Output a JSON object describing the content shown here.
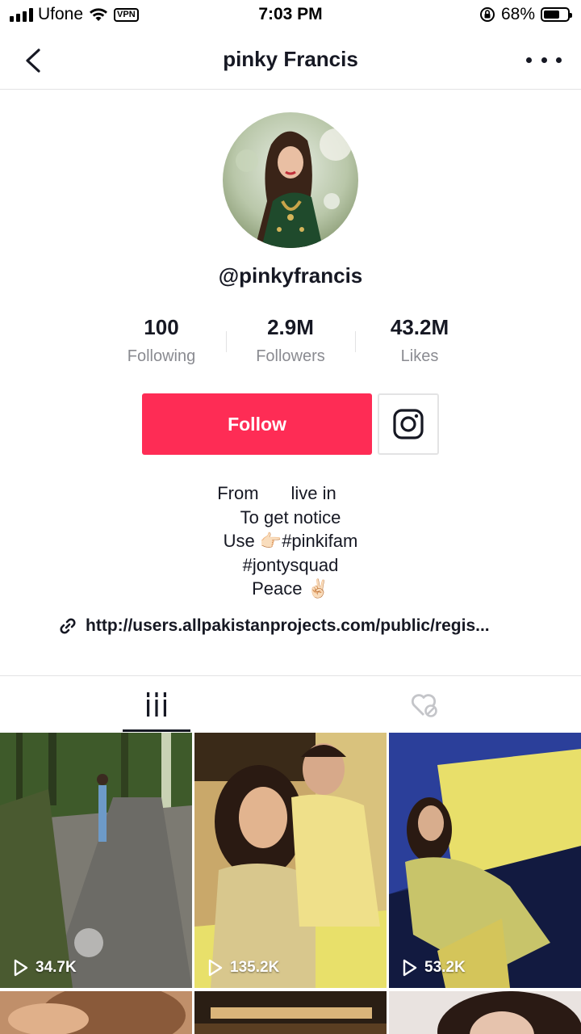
{
  "status_bar": {
    "carrier": "Ufone",
    "vpn_label": "VPN",
    "time": "7:03 PM",
    "battery_percent": "68%",
    "battery_level": 0.68
  },
  "header": {
    "title": "pinky Francis"
  },
  "profile": {
    "username": "@pinkyfrancis",
    "stats": [
      {
        "value": "100",
        "label": "Following"
      },
      {
        "value": "2.9M",
        "label": "Followers"
      },
      {
        "value": "43.2M",
        "label": "Likes"
      }
    ],
    "follow_label": "Follow",
    "bio": {
      "line1_a": "From",
      "line1_b": "live in",
      "line2": "To get notice",
      "line3_a": "Use",
      "line3_b": "#pinkifam",
      "line4": "#jontysquad",
      "line5": "Peace",
      "pointing_emoji": "👉🏻",
      "peace_emoji": "✌🏻"
    },
    "link": "http://users.allpakistanprojects.com/public/regis..."
  },
  "tabs": [
    {
      "name": "videos",
      "icon": "videos-grid-icon",
      "active": true
    },
    {
      "name": "liked",
      "icon": "liked-hidden-heart-icon",
      "active": false
    }
  ],
  "videos": [
    {
      "views": "34.7K"
    },
    {
      "views": "135.2K"
    },
    {
      "views": "53.2K"
    }
  ],
  "colors": {
    "accent": "#fe2c55",
    "text": "#161823",
    "muted": "#8a8b91",
    "divider": "#e3e3e4"
  }
}
